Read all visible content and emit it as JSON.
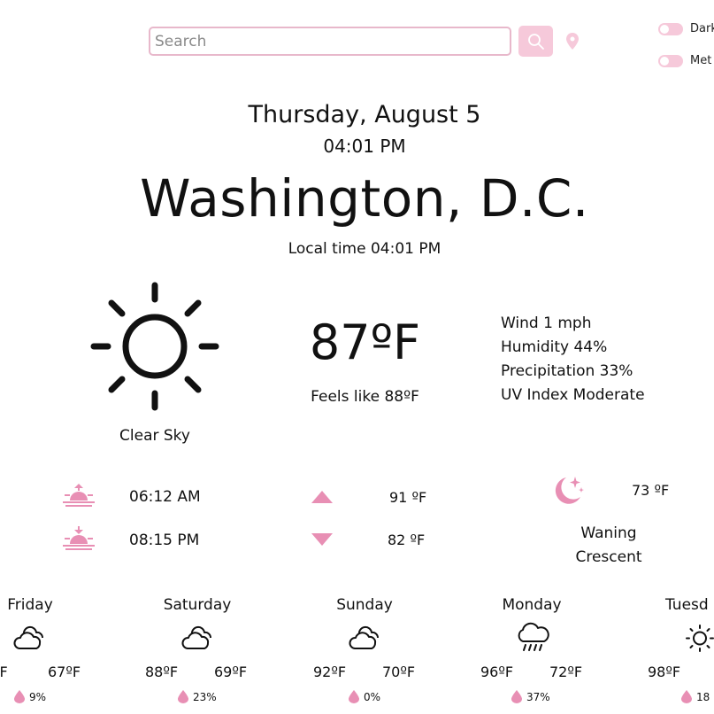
{
  "search": {
    "placeholder": "Search"
  },
  "toggles": {
    "dark_label": "Dark",
    "metric_label": "Met"
  },
  "header": {
    "date": "Thursday, August 5",
    "time": "04:01 PM",
    "city": "Washington, D.C.",
    "local_time": "Local time 04:01 PM"
  },
  "current": {
    "condition": "Clear Sky",
    "temperature": "87ºF",
    "feels_like": "Feels like 88ºF",
    "wind": "Wind 1 mph",
    "humidity": "Humidity 44%",
    "precipitation": "Precipitation 33%",
    "uv": "UV Index Moderate",
    "icon": "sun-icon"
  },
  "astro": {
    "sunrise": "06:12 AM",
    "sunset": "08:15 PM",
    "high": "91 ºF",
    "low": "82 ºF",
    "moon_temp": "73 ºF",
    "moon_phase_line1": "Waning",
    "moon_phase_line2": "Crescent"
  },
  "forecast": [
    {
      "day": "Friday",
      "high": "ºF",
      "low": "67ºF",
      "precip": "9%",
      "icon": "cloud-icon"
    },
    {
      "day": "Saturday",
      "high": "88ºF",
      "low": "69ºF",
      "precip": "23%",
      "icon": "cloud-icon"
    },
    {
      "day": "Sunday",
      "high": "92ºF",
      "low": "70ºF",
      "precip": "0%",
      "icon": "cloud-icon"
    },
    {
      "day": "Monday",
      "high": "96ºF",
      "low": "72ºF",
      "precip": "37%",
      "icon": "rain-cloud-icon"
    },
    {
      "day": "Tuesd",
      "high": "98ºF",
      "low": "",
      "precip": "18",
      "icon": "sun-icon"
    }
  ],
  "colors": {
    "accent": "#e88fb4",
    "accent_light": "#f6c9da",
    "border": "#e8b8cb",
    "text": "#111111"
  }
}
